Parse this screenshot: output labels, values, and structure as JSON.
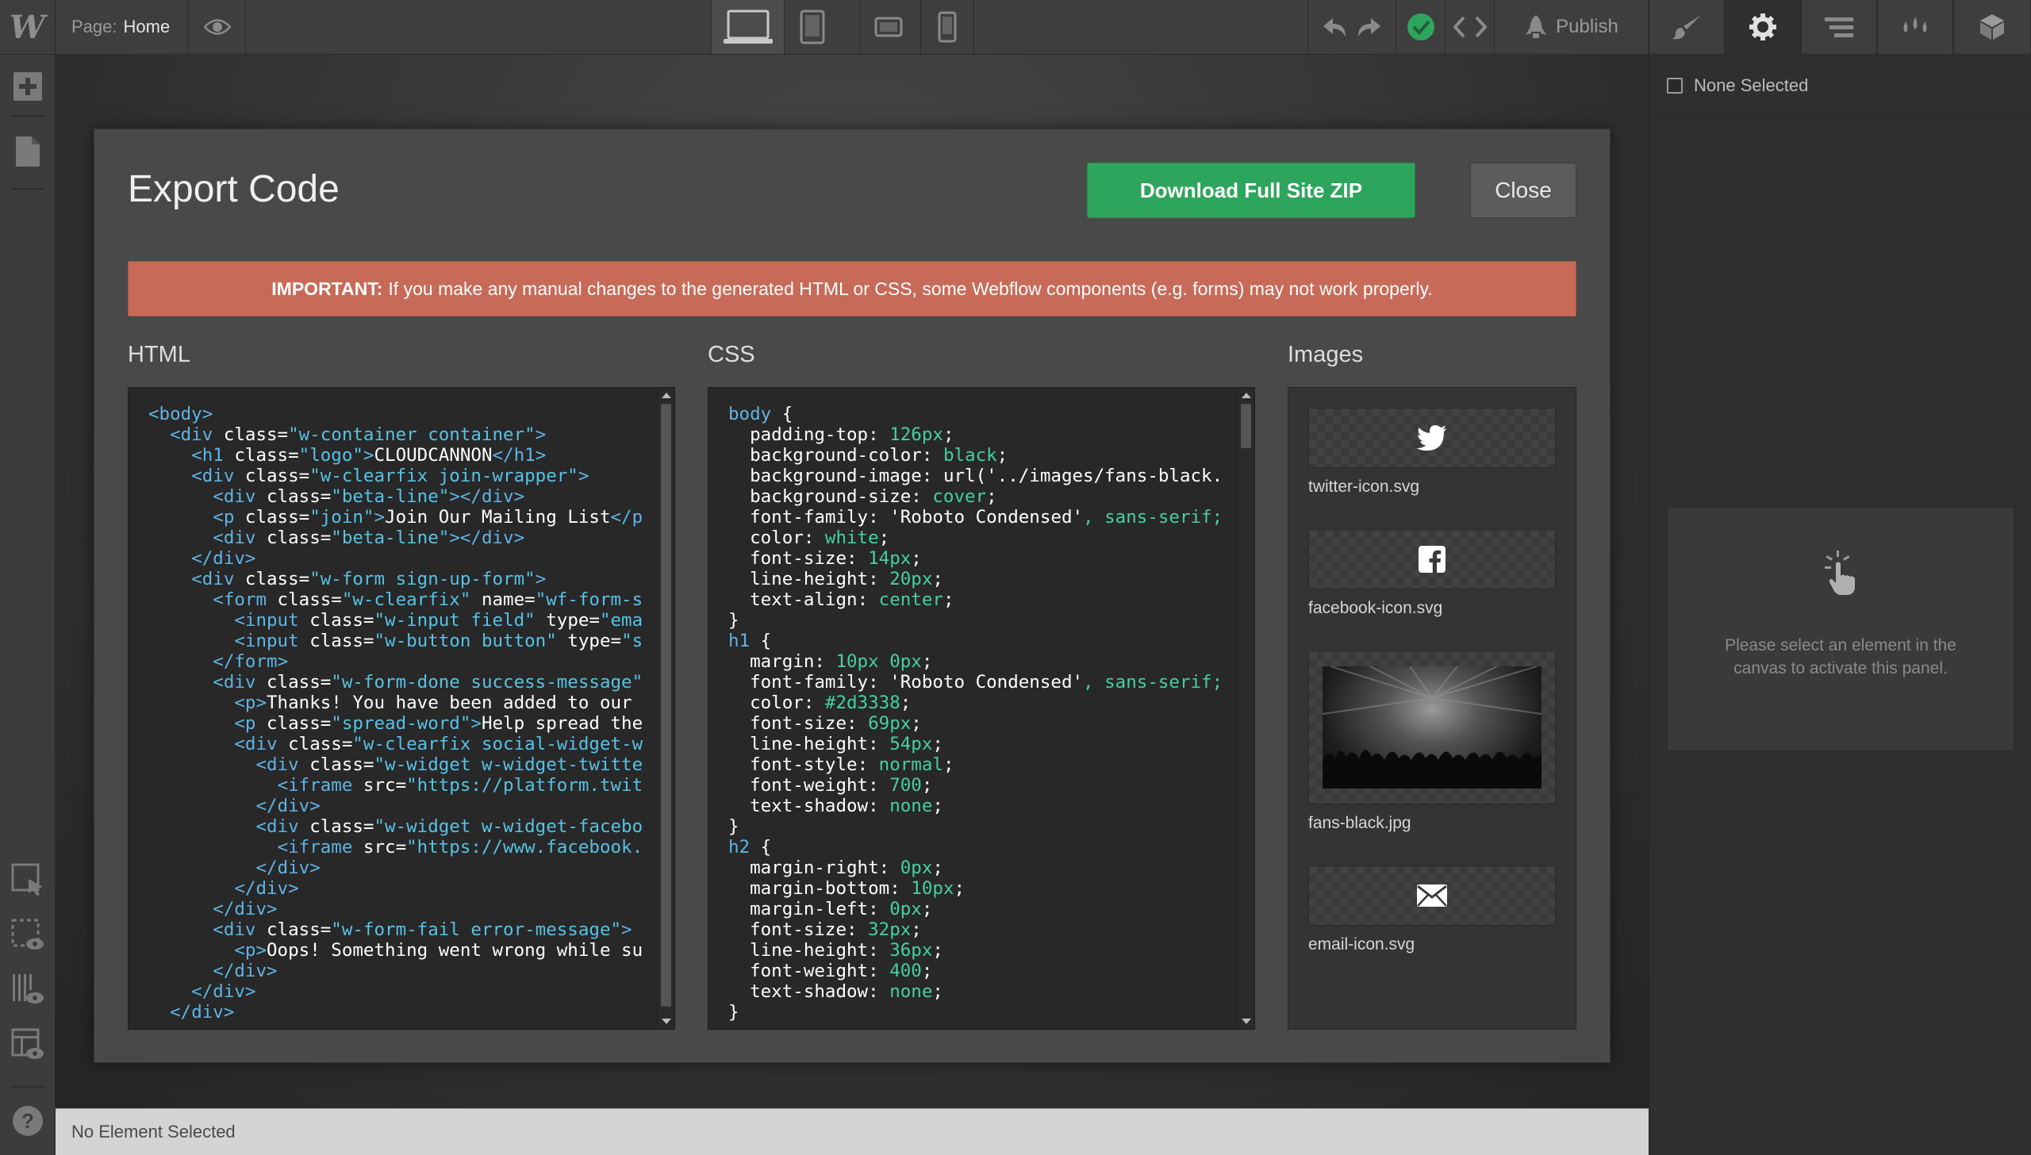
{
  "topbar": {
    "logo": "W",
    "page_label": "Page:",
    "page_value": "Home",
    "publish_label": "Publish",
    "status_color": "#2ea55c"
  },
  "icons": {
    "preview": "eye-icon",
    "devices": [
      "desktop-icon",
      "tablet-icon",
      "tablet-landscape-icon",
      "phone-icon"
    ],
    "history": [
      "undo-icon",
      "redo-icon"
    ],
    "panels": [
      "brush-icon",
      "gear-icon",
      "navigator-icon",
      "interactions-icon",
      "cube-icon"
    ],
    "left_tools": [
      "add-icon",
      "pages-icon",
      "select-box-icon",
      "show-padding-icon",
      "x-ray-icon",
      "preview-layout-icon",
      "help-icon"
    ]
  },
  "modal": {
    "title": "Export Code",
    "download_label": "Download Full Site ZIP",
    "close_label": "Close",
    "warning_strong": "IMPORTANT:",
    "warning_text": "If you make any manual changes to the generated HTML or CSS, some Webflow components (e.g. forms) may not work properly.",
    "html_label": "HTML",
    "css_label": "CSS",
    "images_label": "Images",
    "html_code": [
      "<body>",
      "  <div class=\"w-container container\">",
      "    <h1 class=\"logo\">CLOUDCANNON</h1>",
      "    <div class=\"w-clearfix join-wrapper\">",
      "      <div class=\"beta-line\"></div>",
      "      <p class=\"join\">Join Our Mailing List</p",
      "      <div class=\"beta-line\"></div>",
      "    </div>",
      "    <div class=\"w-form sign-up-form\">",
      "      <form class=\"w-clearfix\" name=\"wf-form-s",
      "        <input class=\"w-input field\" type=\"ema",
      "        <input class=\"w-button button\" type=\"s",
      "      </form>",
      "      <div class=\"w-form-done success-message\"",
      "        <p>Thanks! You have been added to our",
      "        <p class=\"spread-word\">Help spread the",
      "        <div class=\"w-clearfix social-widget-w",
      "          <div class=\"w-widget w-widget-twitte",
      "            <iframe src=\"https://platform.twit",
      "          </div>",
      "          <div class=\"w-widget w-widget-facebo",
      "            <iframe src=\"https://www.facebook.",
      "          </div>",
      "        </div>",
      "      </div>",
      "      <div class=\"w-form-fail error-message\">",
      "        <p>Oops! Something went wrong while su",
      "      </div>",
      "    </div>",
      "  </div>"
    ],
    "css_code": [
      "body {",
      "  padding-top: 126px;",
      "  background-color: black;",
      "  background-image: url('../images/fans-black.",
      "  background-size: cover;",
      "  font-family: 'Roboto Condensed', sans-serif;",
      "  color: white;",
      "  font-size: 14px;",
      "  line-height: 20px;",
      "  text-align: center;",
      "}",
      "h1 {",
      "  margin: 10px 0px;",
      "  font-family: 'Roboto Condensed', sans-serif;",
      "  color: #2d3338;",
      "  font-size: 69px;",
      "  line-height: 54px;",
      "  font-style: normal;",
      "  font-weight: 700;",
      "  text-shadow: none;",
      "}",
      "h2 {",
      "  margin-right: 0px;",
      "  margin-bottom: 10px;",
      "  margin-left: 0px;",
      "  font-size: 32px;",
      "  line-height: 36px;",
      "  font-weight: 400;",
      "  text-shadow: none;",
      "}"
    ],
    "images": [
      {
        "name": "twitter-icon.svg",
        "icon": "twitter-icon"
      },
      {
        "name": "facebook-icon.svg",
        "icon": "facebook-icon"
      },
      {
        "name": "fans-black.jpg",
        "icon": "photo"
      },
      {
        "name": "email-icon.svg",
        "icon": "email-icon"
      }
    ]
  },
  "right_panel": {
    "none_selected": "None Selected",
    "info_text": "Please select an element in the canvas to activate this panel."
  },
  "statusbar": {
    "text": "No Element Selected"
  },
  "colors": {
    "code_tag": "#5fb4e6",
    "code_attr": "#ffffff",
    "code_string": "#56c2e6",
    "code_value": "#45cfa4",
    "code_text": "#ffffff"
  }
}
